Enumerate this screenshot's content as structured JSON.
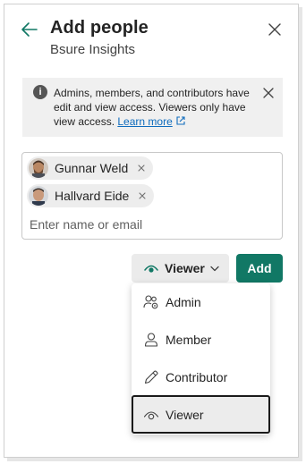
{
  "header": {
    "title": "Add people",
    "subtitle": "Bsure Insights",
    "back_icon": "arrow-left-icon",
    "close_icon": "close-icon"
  },
  "info": {
    "text": "Admins, members, and contributors have edit and view access. Viewers only have view access.",
    "link": "Learn more",
    "icon": "info-icon"
  },
  "people": {
    "chips": [
      {
        "name": "Gunnar Weld"
      },
      {
        "name": "Hallvard Eide"
      }
    ],
    "placeholder": "Enter name or email"
  },
  "role": {
    "selected": "Viewer",
    "options": [
      {
        "label": "Admin",
        "icon": "admin-people-gear-icon"
      },
      {
        "label": "Member",
        "icon": "person-icon"
      },
      {
        "label": "Contributor",
        "icon": "pencil-icon"
      },
      {
        "label": "Viewer",
        "icon": "eye-icon"
      }
    ]
  },
  "actions": {
    "add_label": "Add"
  },
  "colors": {
    "accent": "#117865",
    "link": "#0f6cbd"
  }
}
